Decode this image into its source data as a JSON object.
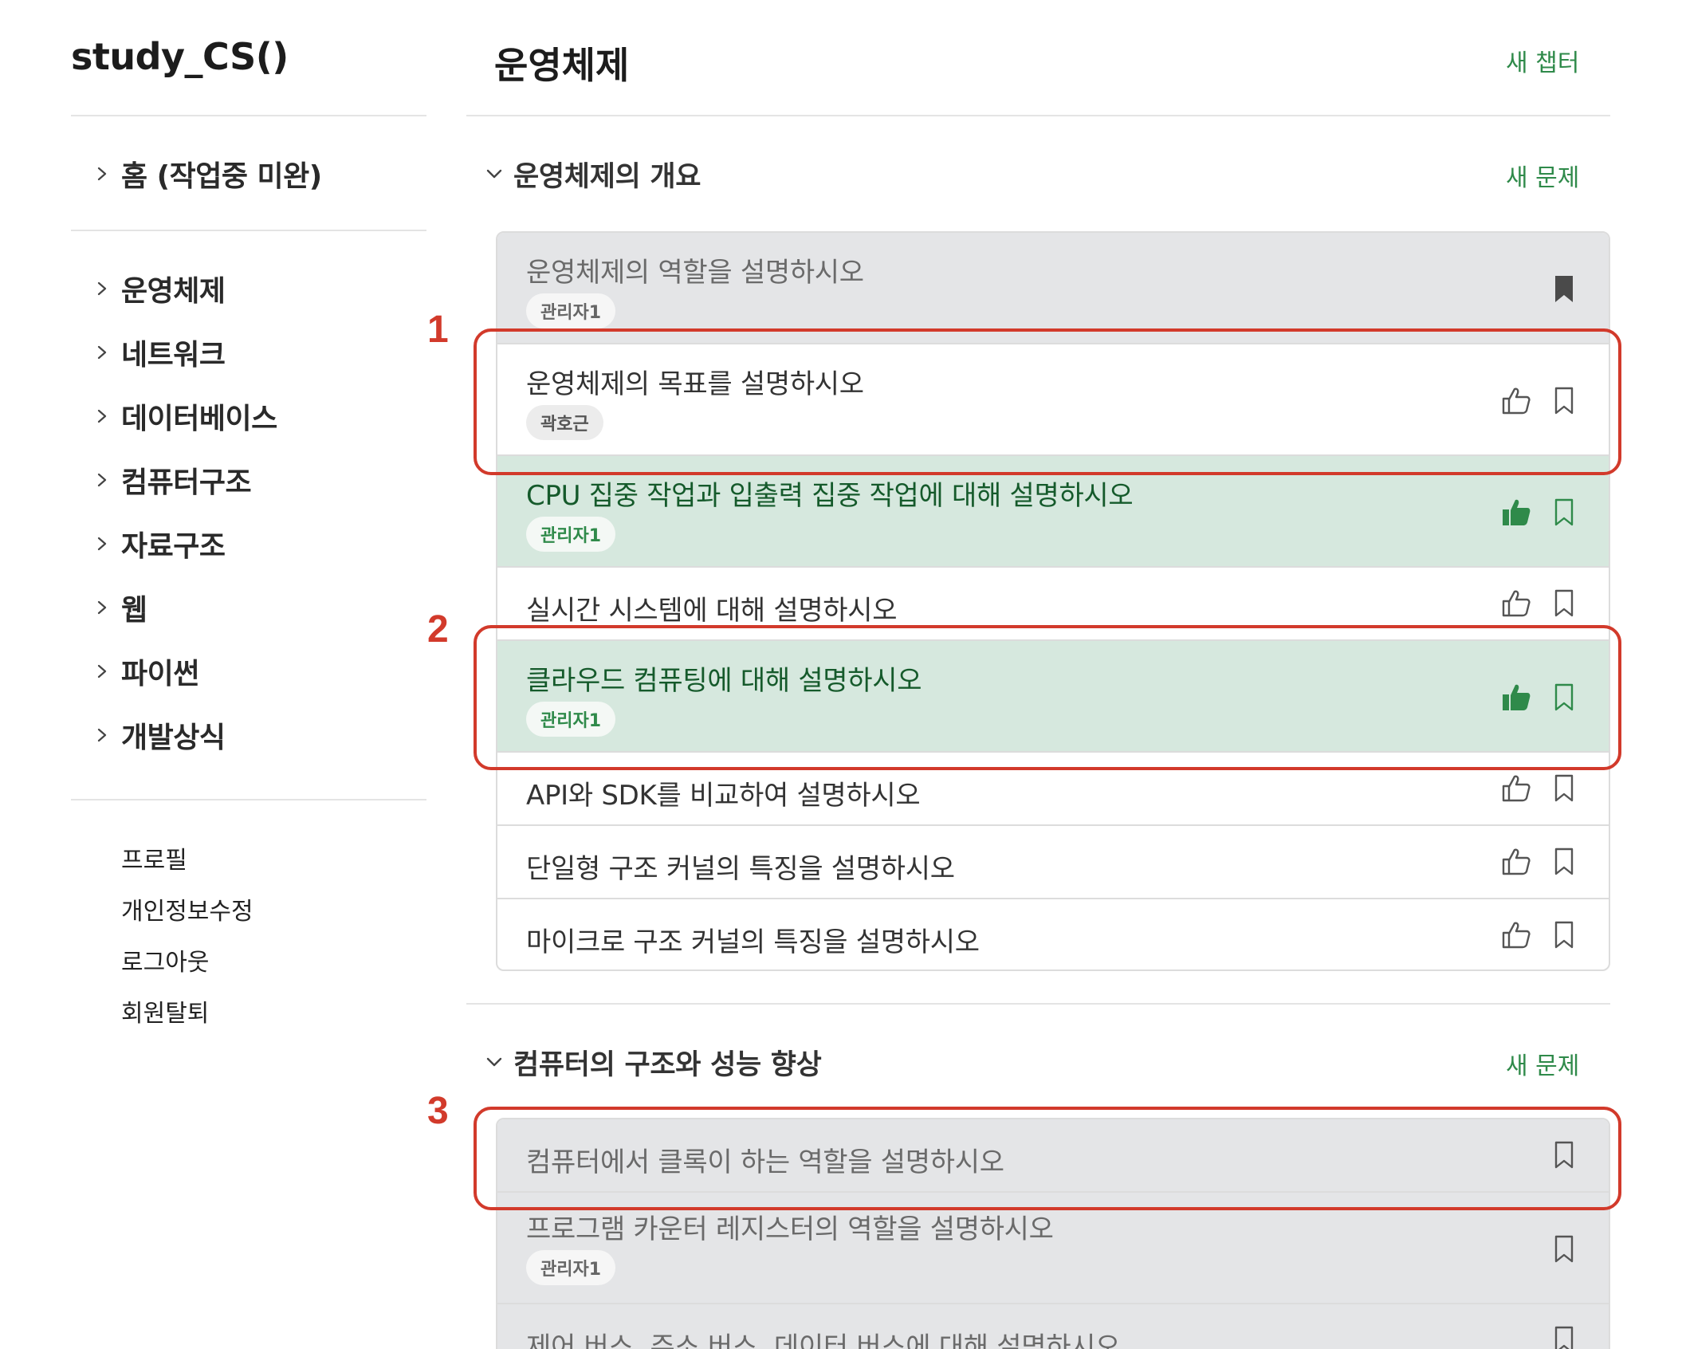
{
  "app": {
    "brand": "study_CS()"
  },
  "sidebar": {
    "home_label": "홈 (작업중 미완)",
    "categories": [
      {
        "label": "운영체제"
      },
      {
        "label": "네트워크"
      },
      {
        "label": "데이터베이스"
      },
      {
        "label": "컴퓨터구조"
      },
      {
        "label": "자료구조"
      },
      {
        "label": "웹"
      },
      {
        "label": "파이썬"
      },
      {
        "label": "개발상식"
      }
    ],
    "account": [
      {
        "label": "프로필"
      },
      {
        "label": "개인정보수정"
      },
      {
        "label": "로그아웃"
      },
      {
        "label": "회원탈퇴"
      }
    ]
  },
  "main": {
    "title": "운영체제",
    "new_chapter_label": "새 챕터",
    "sections": [
      {
        "title": "운영체제의 개요",
        "new_question_label": "새 문제",
        "questions": [
          {
            "text": "운영체제의 역할을 설명하시오",
            "author": "관리자1",
            "state": "gray"
          },
          {
            "text": "운영체제의 목표를 설명하시오",
            "author": "곽호근",
            "state": "normal"
          },
          {
            "text": "CPU 집중 작업과 입출력 집중 작업에 대해 설명하시오",
            "author": "관리자1",
            "state": "liked"
          },
          {
            "text": "실시간 시스템에 대해 설명하시오",
            "state": "normal"
          },
          {
            "text": "클라우드 컴퓨팅에 대해 설명하시오",
            "author": "관리자1",
            "state": "liked"
          },
          {
            "text": "API와 SDK를 비교하여 설명하시오",
            "state": "normal"
          },
          {
            "text": "단일형 구조 커널의 특징을 설명하시오",
            "state": "normal"
          },
          {
            "text": "마이크로 구조 커널의 특징을 설명하시오",
            "state": "normal"
          }
        ]
      },
      {
        "title": "컴퓨터의 구조와 성능 향상",
        "new_question_label": "새 문제",
        "questions": [
          {
            "text": "컴퓨터에서 클록이 하는 역할을 설명하시오",
            "state": "gray"
          },
          {
            "text": "프로그램 카운터 레지스터의 역할을 설명하시오",
            "author": "관리자1",
            "state": "gray"
          },
          {
            "text": "제어 버스, 주소 버스, 데이터 버스에 대해 설명하시오",
            "state": "gray"
          }
        ]
      }
    ]
  },
  "annotations": [
    "1",
    "2",
    "3"
  ],
  "colors": {
    "accent_green": "#2f8a4a",
    "liked_row_bg": "#d6e8de",
    "gray_row_bg": "#e4e5e7",
    "annotation_red": "#d23a2b"
  },
  "icons": {
    "chevron_right": "chevron-right-icon",
    "chevron_down": "chevron-down-icon",
    "thumbs_up_outline": "thumbs-up-icon",
    "thumbs_up_filled": "thumbs-up-filled-icon",
    "bookmark_outline": "bookmark-icon",
    "bookmark_filled": "bookmark-filled-icon"
  }
}
